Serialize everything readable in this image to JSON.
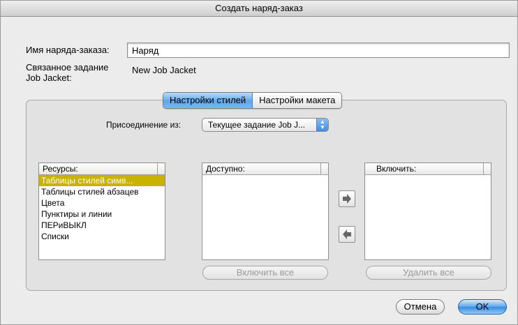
{
  "window": {
    "title": "Создать наряд-заказ"
  },
  "form": {
    "name_label": "Имя наряда-заказа:",
    "name_value": "Наряд",
    "linked_label_line1": "Связанное задание",
    "linked_label_line2": "Job Jacket:",
    "linked_value": "New Job Jacket"
  },
  "tabs": [
    {
      "label": "Настройки стилей",
      "active": true
    },
    {
      "label": "Настройки макета",
      "active": false
    }
  ],
  "attach": {
    "label": "Присоединение из:",
    "selected": "Текущее задание Job J..."
  },
  "resources": {
    "header": "Ресурсы:",
    "items": [
      "Таблицы стилей симв...",
      "Таблицы стилей абзацев",
      "Цвета",
      "Пунктиры и линии",
      "ПЕРиВЫКЛ",
      "Списки"
    ],
    "selected_index": 0
  },
  "available": {
    "header": "Доступно:",
    "include_all_label": "Включить все"
  },
  "include": {
    "header": "Включить:",
    "remove_all_label": "Удалить все"
  },
  "icons": {
    "add": "arrow-right-icon",
    "remove": "arrow-left-icon",
    "popup": "updown-arrows-icon"
  },
  "colors": {
    "selection": "#c8b400",
    "accent": "#5aa4ec"
  },
  "buttons": {
    "cancel": "Отмена",
    "ok": "OK"
  }
}
